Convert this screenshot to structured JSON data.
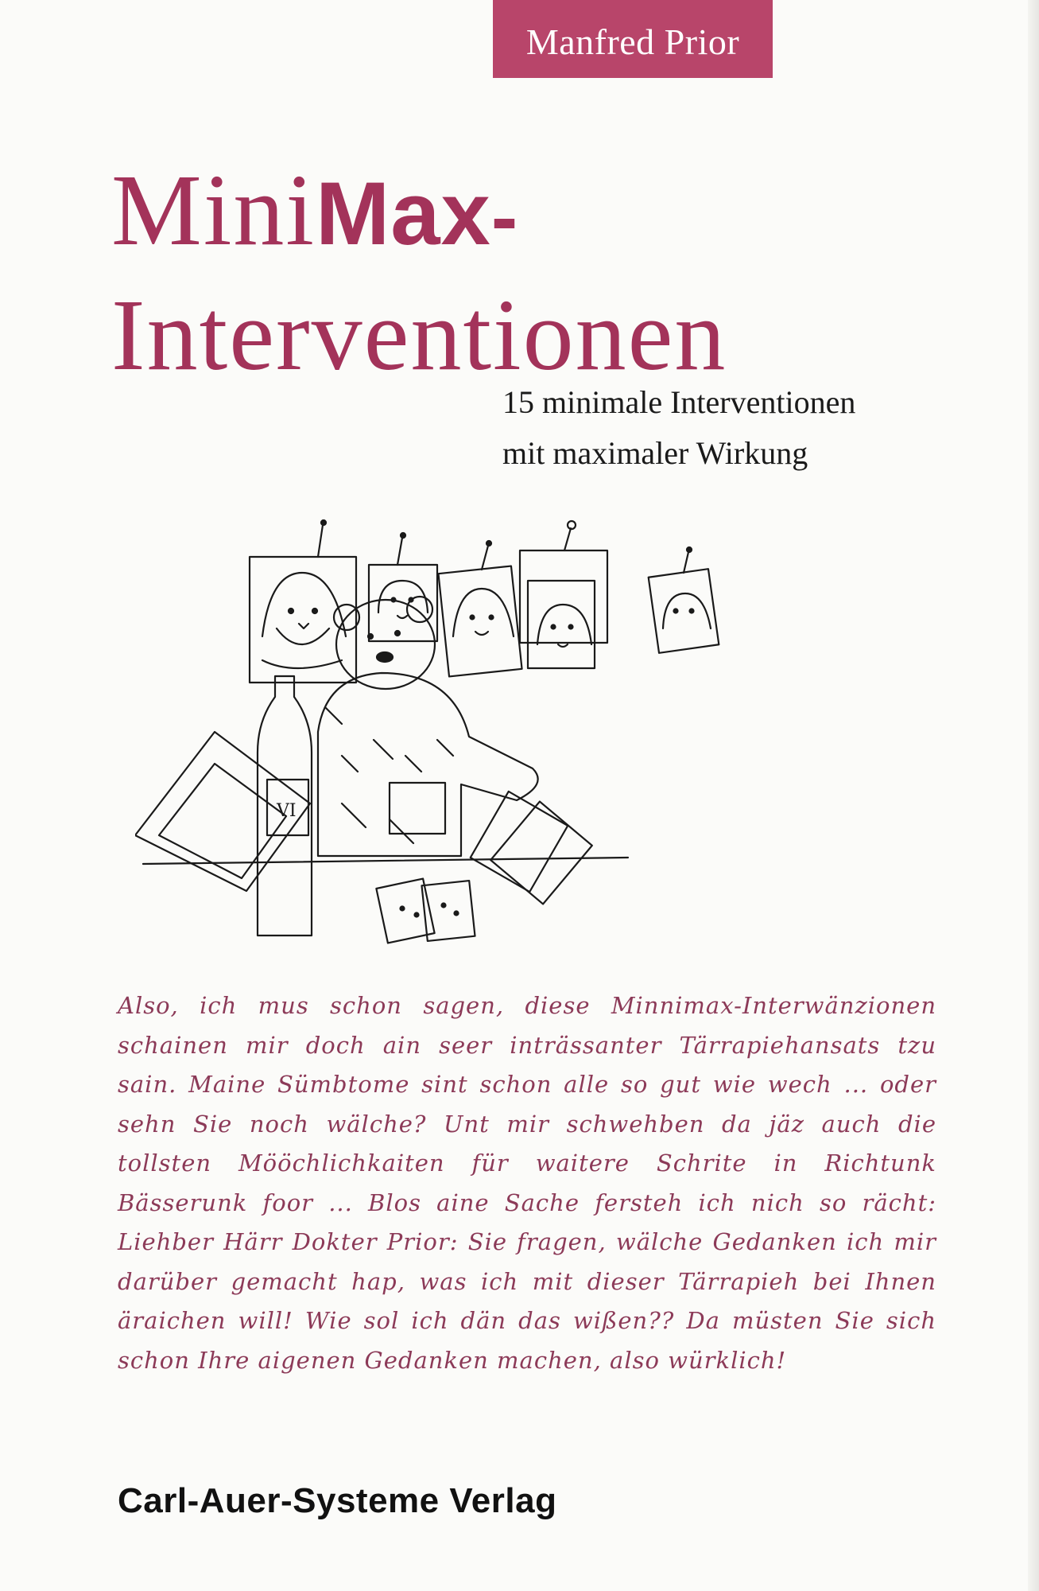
{
  "author": "Manfred Prior",
  "title": {
    "line1_light": "Mini",
    "line1_bold": "Max",
    "line1_dash": "-",
    "line2": "Interventionen"
  },
  "subtitle": {
    "line1": "15 minimale Interventionen",
    "line2": "mit maximaler Wirkung"
  },
  "illustration": {
    "description_icon": "bear-at-desk-drawing-icon",
    "bottle_label": "VI"
  },
  "blurb": "Also, ich mus schon sagen, diese Minnimax-Interwänzionen schainen mir doch ain seer inträssanter Tärrapiehansats tzu sain. Maine Sümbtome sint schon alle so gut wie wech ... oder sehn Sie noch wälche? Unt mir schwehben da jäz auch die tollsten Mööchlichkaiten für waitere Schrite in Richtunk Bässerunk foor ... Blos aine Sache fersteh ich nich so rächt: Liehber Härr Dokter Prior: Sie fragen, wälche Gedanken ich mir darüber gemacht hap, was ich mit dieser Tärrapieh bei Ihnen äraichen will! Wie sol ich dän das wißen?? Da müsten Sie sich schon Ihre aigenen Gedanken machen, also würklich!",
  "publisher": "Carl-Auer-Systeme Verlag",
  "colors": {
    "accent": "#b8456a",
    "title": "#a3335a",
    "blurb": "#8c3a58",
    "background": "#fbfbf9"
  }
}
